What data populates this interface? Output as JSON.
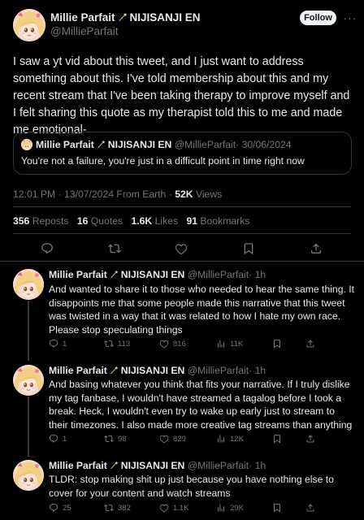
{
  "main": {
    "name": "Millie Parfait",
    "affiliation": "NIJISANJI EN",
    "handle": "@MillieParfait",
    "follow_label": "Follow",
    "more_label": "···",
    "body": "I saw a yt vid about this tweet, and I just want to address something about this. I've told membership about this and my recent stream that I've been taking therapy to improve myself and I felt sharing this quote as my therapist told this to me and made me emotional-",
    "quote": {
      "name": "Millie Parfait",
      "affiliation": "NIJISANJI EN",
      "handle": "@MillieParfait",
      "date": "· 30/06/2024",
      "text": "You're not a failure, you're just in a difficult point in time right now"
    },
    "meta": {
      "time": "12:01 PM",
      "date": "· 13/07/2024 From Earth ·",
      "views_count": "52K",
      "views_label": "Views"
    },
    "stats": {
      "reposts_count": "356",
      "reposts_label": "Reposts",
      "quotes_count": "16",
      "quotes_label": "Quotes",
      "likes_count": "1.6K",
      "likes_label": "Likes",
      "bookmarks_count": "91",
      "bookmarks_label": "Bookmarks"
    }
  },
  "replies": [
    {
      "name": "Millie Parfait",
      "affiliation": "NIJISANJI EN",
      "handle": "@MillieParfait",
      "time": "· 1h",
      "body": "And wanted to share it to those who needed to hear the same thing. It disappoints me that some people made this narrative that this tweet was twisted in a way that it was related to how I hate my own race. Please stop speculating things",
      "replies": "1",
      "reposts": "113",
      "likes": "816",
      "views": "11K"
    },
    {
      "name": "Millie Parfait",
      "affiliation": "NIJISANJI EN",
      "handle": "@MillieParfait",
      "time": "· 1h",
      "body": "And basing whatever you think that fits your narrative. If I truly dislike my tag fanbase, I wouldn't have streamed a tagalog before I took a break. Heck, I wouldn't even try to wake up early just to stream to their timezones. I also made more creative tag streams than anything",
      "replies": "1",
      "reposts": "98",
      "likes": "829",
      "views": "12K"
    },
    {
      "name": "Millie Parfait",
      "affiliation": "NIJISANJI EN",
      "handle": "@MillieParfait",
      "time": "· 1h",
      "body": "TLDR: stop making shit up just because you have nothing else to cover for your content and watch streams",
      "replies": "25",
      "reposts": "382",
      "likes": "1.1K",
      "views": "29K"
    }
  ],
  "colors": {
    "background": "#000000",
    "text": "#e7e9ea",
    "secondary": "#71767b",
    "border": "#2f3336"
  }
}
